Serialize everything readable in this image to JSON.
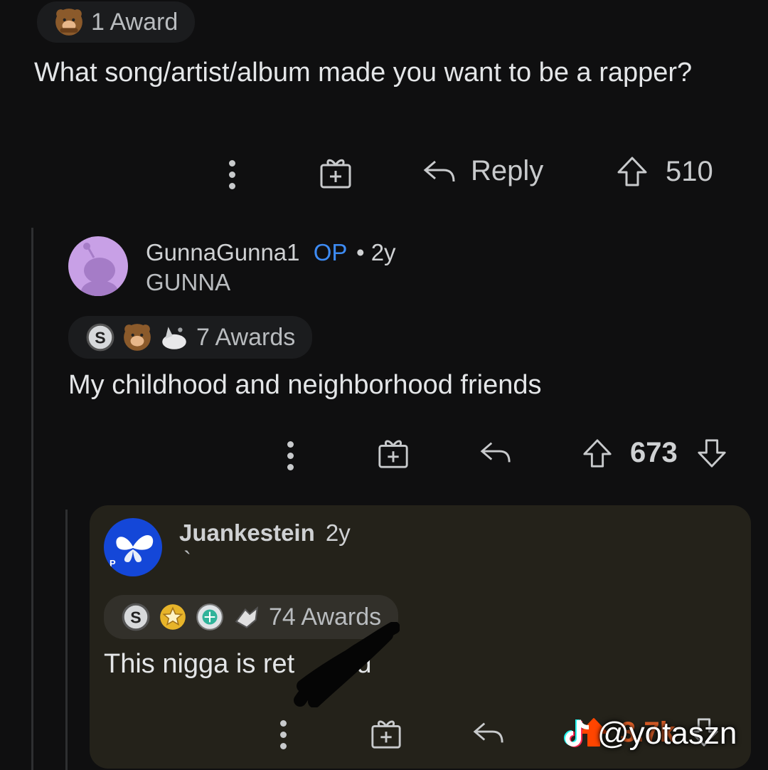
{
  "post": {
    "award_label": "1 Award",
    "title": "What song/artist/album made you want to be a rapper?",
    "reply_label": "Reply",
    "vote_count": "510"
  },
  "comment1": {
    "username": "GunnaGunna1",
    "op_tag": "OP",
    "separator": "•",
    "age": "2y",
    "flair": "GUNNA",
    "awards_label": "7 Awards",
    "text": "My childhood and neighborhood friends",
    "vote_count": "673"
  },
  "comment2": {
    "username": "Juankestein",
    "age": "2y",
    "flair": "`",
    "avatar_badge": "P",
    "awards_label": "74 Awards",
    "text": "This nigga is ret",
    "text_tail": "ed",
    "vote_count": "3.7k"
  },
  "watermark": {
    "handle": "@yotaszn"
  },
  "colors": {
    "background": "#0f0f10",
    "op_blue": "#3d8bf3",
    "highlight_bg": "#24221a"
  }
}
